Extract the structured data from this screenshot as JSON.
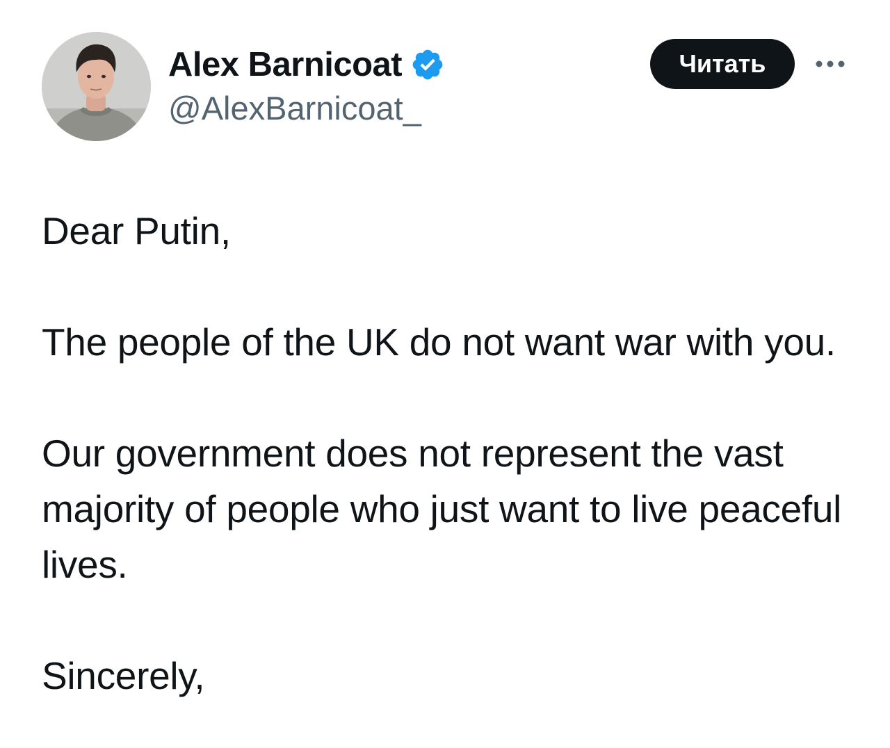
{
  "author": {
    "display_name": "Alex Barnicoat",
    "handle": "@AlexBarnicoat_",
    "verified": true,
    "avatar_icon": "user-avatar-photo"
  },
  "actions": {
    "follow_label": "Читать",
    "more_icon": "more-horizontal-icon"
  },
  "tweet": {
    "paragraphs": [
      "Dear Putin,",
      "The people of the UK do not want war with you.",
      "Our government does not represent the vast majority of people who just want to live peaceful lives.",
      "Sincerely,"
    ]
  },
  "colors": {
    "text": "#0f1419",
    "secondary": "#536471",
    "verified": "#1d9bf0",
    "button_bg": "#0f1419",
    "button_text": "#ffffff"
  }
}
